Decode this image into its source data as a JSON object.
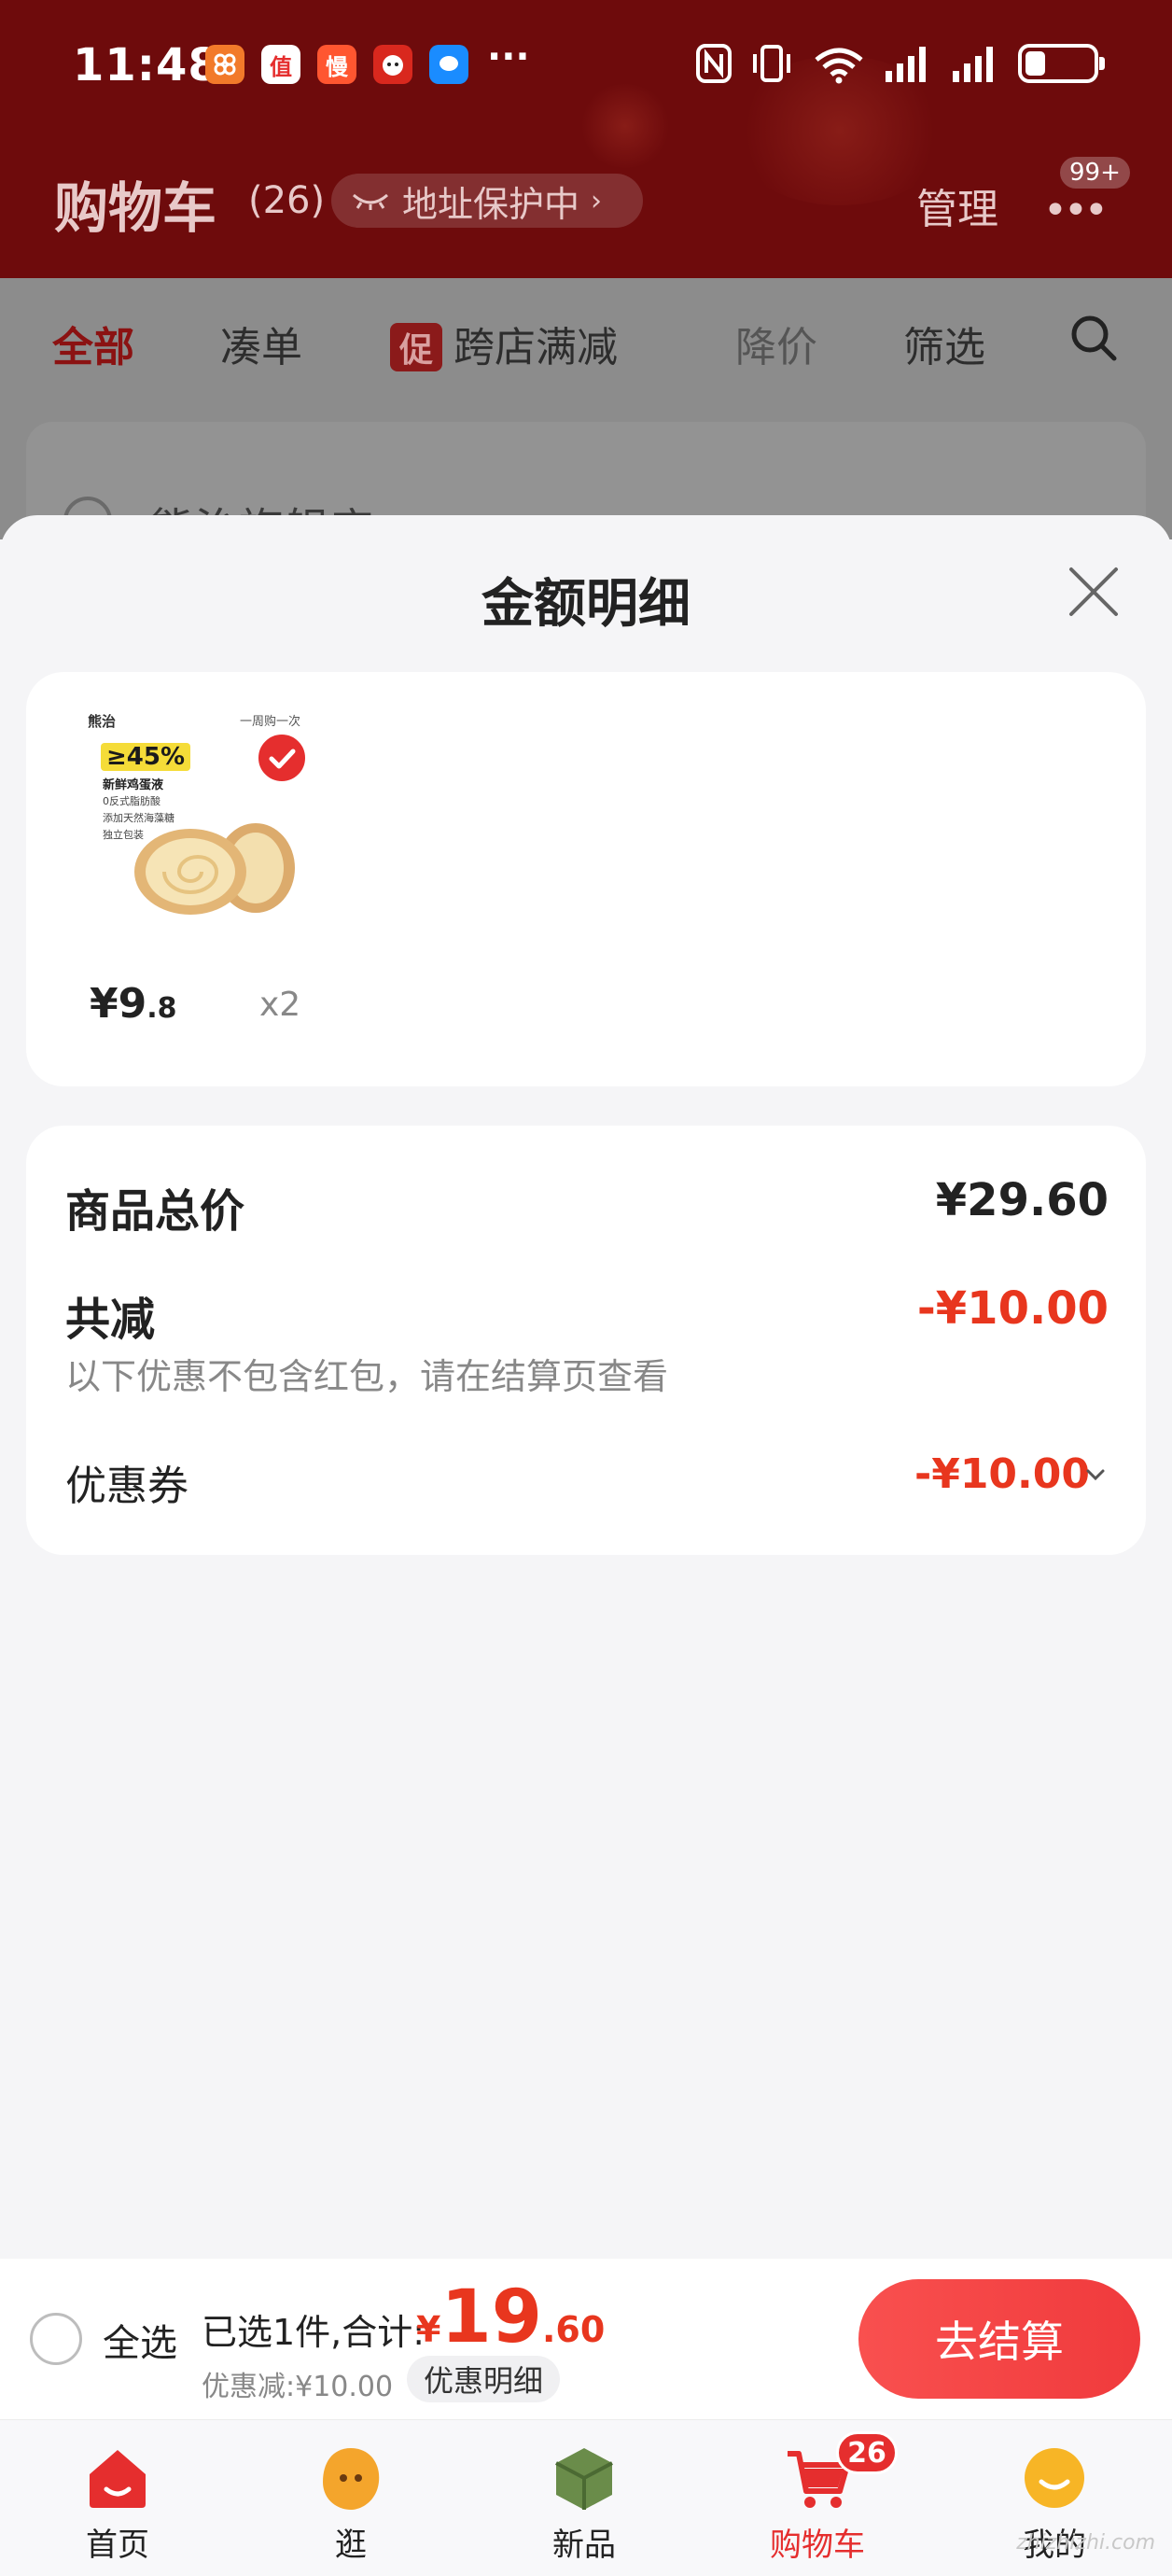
{
  "status_bar": {
    "time": "11:48",
    "apps": [
      "app-icon-1",
      "app-icon-2",
      "app-icon-3",
      "app-icon-4",
      "app-icon-5"
    ],
    "more": "···",
    "battery_level": 0.3
  },
  "header": {
    "title": "购物车",
    "count": "(26)",
    "address_protect": "地址保护中",
    "manage": "管理",
    "more_badge": "99+"
  },
  "tabs": [
    {
      "label": "全部",
      "active": true
    },
    {
      "label": "凑单"
    },
    {
      "label": "跨店满减",
      "tag": "促"
    },
    {
      "label": "降价"
    },
    {
      "label": "筛选"
    }
  ],
  "store_name": "熊治旗舰店",
  "sheet": {
    "title": "金额明细",
    "product": {
      "brand_text": "熊治",
      "promo_text": "一周购一次",
      "image_percent": "≥45%",
      "image_sub": "新鲜鸡蛋液",
      "image_lines": [
        "0反式脂肪酸",
        "添加天然海藻糖",
        "独立包装"
      ],
      "price_int": "¥9",
      "price_dec": ".8",
      "qty": "x2"
    },
    "summary": {
      "total_label": "商品总价",
      "total_value": "¥29.60",
      "reduce_label": "共减",
      "reduce_value": "-¥10.00",
      "reduce_note": "以下优惠不包含红包，请在结算页查看",
      "coupon_label": "优惠券",
      "coupon_value": "-¥10.00"
    }
  },
  "checkout": {
    "select_all": "全选",
    "selected_text": "已选1件,合计:",
    "total_yen": "¥",
    "total_big": "19",
    "total_small": ".60",
    "discount_text": "优惠减:¥10.00",
    "detail_button": "优惠明细",
    "checkout_button": "去结算"
  },
  "nav": {
    "items": [
      {
        "label": "首页",
        "icon": "home-icon"
      },
      {
        "label": "逛",
        "icon": "browse-icon"
      },
      {
        "label": "新品",
        "icon": "new-products-icon"
      },
      {
        "label": "购物车",
        "icon": "cart-icon",
        "badge": "26",
        "active": true
      },
      {
        "label": "我的",
        "icon": "profile-icon"
      }
    ]
  },
  "watermark": "zhizhizhi.com",
  "colors": {
    "header_bg": "#6e0b0c",
    "accent_red": "#e8361e",
    "button_red": "#f03a3c",
    "page_bg": "#f5f5f7"
  }
}
